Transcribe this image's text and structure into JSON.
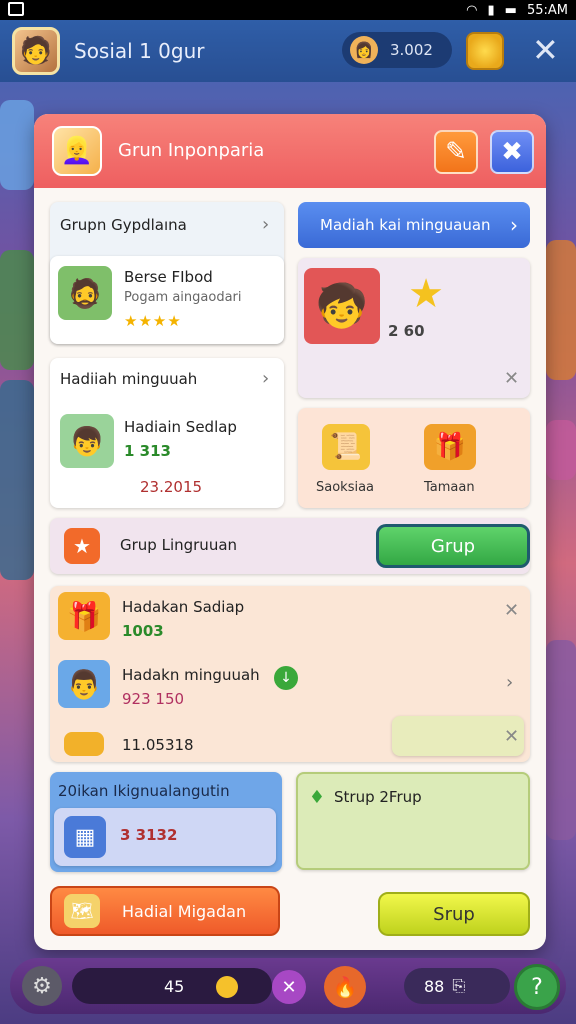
{
  "status": {
    "time": "55:AM"
  },
  "topbar": {
    "title": "Sosial 1 0gur",
    "coins": "3.002"
  },
  "modal": {
    "title": "Grun Inponparia",
    "group_card": {
      "title": "Grupn Gypdlaına",
      "friend_name": "Berse FIbod",
      "friend_sub": "Pogam aingaodari",
      "stars": "★★★★"
    },
    "blue_button": "Madiah kai minguauan",
    "reward_card": {
      "amount": "2 60"
    },
    "weekly_card": {
      "title": "Hadiiah minguuah",
      "name": "Hadiain Sedlap",
      "points": "1 313",
      "value": "23.2015"
    },
    "items": [
      {
        "label": "Saoksiaa"
      },
      {
        "label": "Tamaan"
      }
    ],
    "group_row": {
      "label": "Grup Lingruuan",
      "button": "Grup"
    },
    "rewards_list": [
      {
        "title": "Hadakan Sadiap",
        "value": "1003"
      },
      {
        "title": "Hadakn minguuah",
        "value": "923 150"
      },
      {
        "title": "",
        "value": "11.05318"
      }
    ],
    "bottom_left": {
      "title": "20ikan Ikignualangutin",
      "value": "3 3132"
    },
    "bottom_right": {
      "title": "Strup 2Frup"
    },
    "orange_button": "Hadial Migadan",
    "yellow_button": "Srup"
  },
  "bottombar": {
    "count": "45",
    "right_count": "88"
  }
}
